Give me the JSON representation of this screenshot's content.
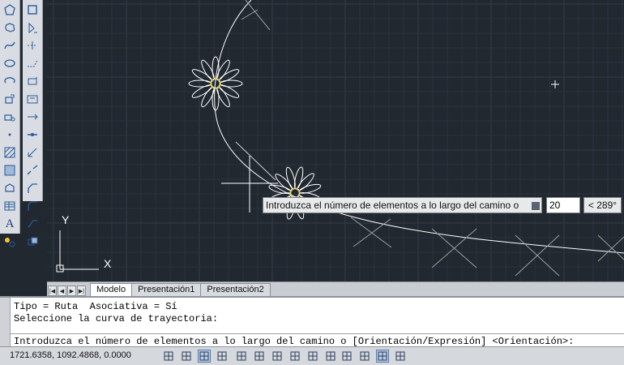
{
  "toolbar_left": {
    "tools": [
      "polygon-tool",
      "revision-cloud-tool",
      "spline-tool",
      "ellipse-tool",
      "ellipse-arc-tool",
      "insert-block-tool",
      "make-block-tool",
      "point-tool",
      "hatch-tool",
      "gradient-tool",
      "region-tool",
      "table-tool",
      "multiline-text-tool",
      "add-selected-tool"
    ],
    "text_icon": "A"
  },
  "toolbar_right": {
    "tools": [
      "mirror-tool",
      "offset-tool",
      "array-tool",
      "move-tool",
      "rotate-tool",
      "scale-tool",
      "stretch-tool",
      "trim-tool",
      "extend-tool",
      "break-tool",
      "chamfer-tool",
      "fillet-tool",
      "blend-curves-tool",
      "explode-tool"
    ]
  },
  "ucs": {
    "y_label": "Y",
    "x_label": "X"
  },
  "layout_tabs": [
    "Modelo",
    "Presentación1",
    "Presentación2"
  ],
  "active_tab": "Modelo",
  "command": {
    "history": [
      "Tipo = Ruta  Asociativa = Sí",
      "Seleccione la curva de trayectoria:"
    ],
    "current": "Introduzca el número de elementos a lo largo del camino o [Orientación/Expresión] <Orientación>:"
  },
  "dynamic_prompt": {
    "text": "Introduzca el número de elementos a lo largo del camino o",
    "input_value": "20",
    "angle": "< 289°"
  },
  "status": {
    "coordinates": "1721.6358, 1092.4868, 0.0000",
    "buttons": [
      "infer-constraints",
      "snap-mode",
      "grid-display",
      "ortho-mode",
      "polar-tracking",
      "object-snap",
      "3d-object-snap",
      "object-snap-tracking",
      "dynamic-ucs",
      "dynamic-input",
      "lineweight",
      "transparency",
      "quick-properties",
      "selection-cycling"
    ]
  },
  "colors": {
    "canvas": "#212830",
    "grid_minor": "#2a323c",
    "grid_major": "#333c47",
    "geometry": "#ffffff",
    "highlight": "#e3d34a"
  }
}
